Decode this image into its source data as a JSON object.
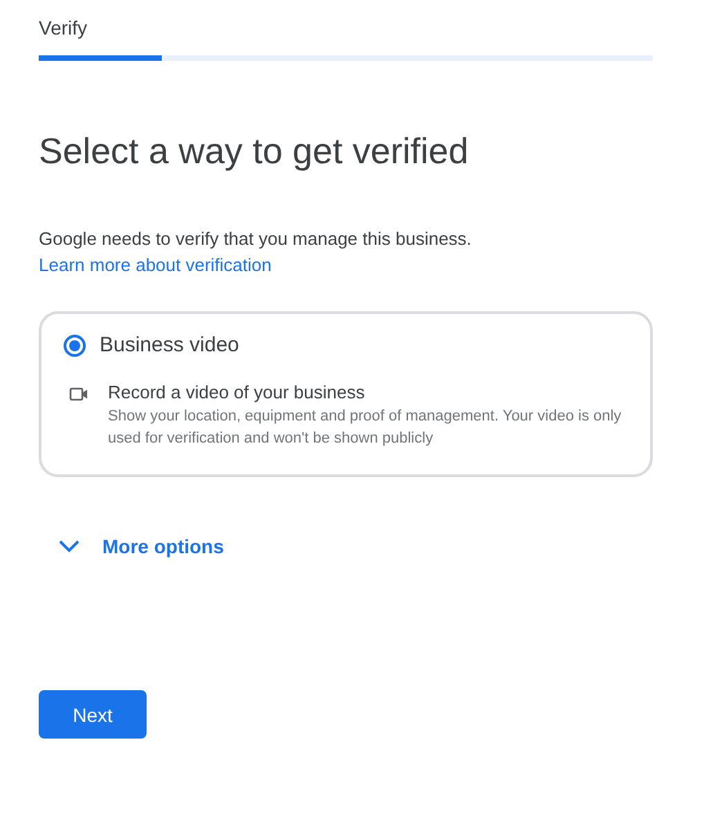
{
  "header": {
    "title": "Verify"
  },
  "progress": {
    "level": 0.2
  },
  "heading": "Select a way to get verified",
  "description": "Google needs to verify that you manage this business.",
  "learn_more_link": "Learn more about verification",
  "options": [
    {
      "label": "Business video",
      "selected": true,
      "detail_title": "Record a video of your business",
      "detail_text": "Show your location, equipment and proof of management. Your video is only used for verification and won't be shown publicly"
    }
  ],
  "more_options": {
    "label": "More options",
    "expanded": false
  },
  "next_button": "Next"
}
